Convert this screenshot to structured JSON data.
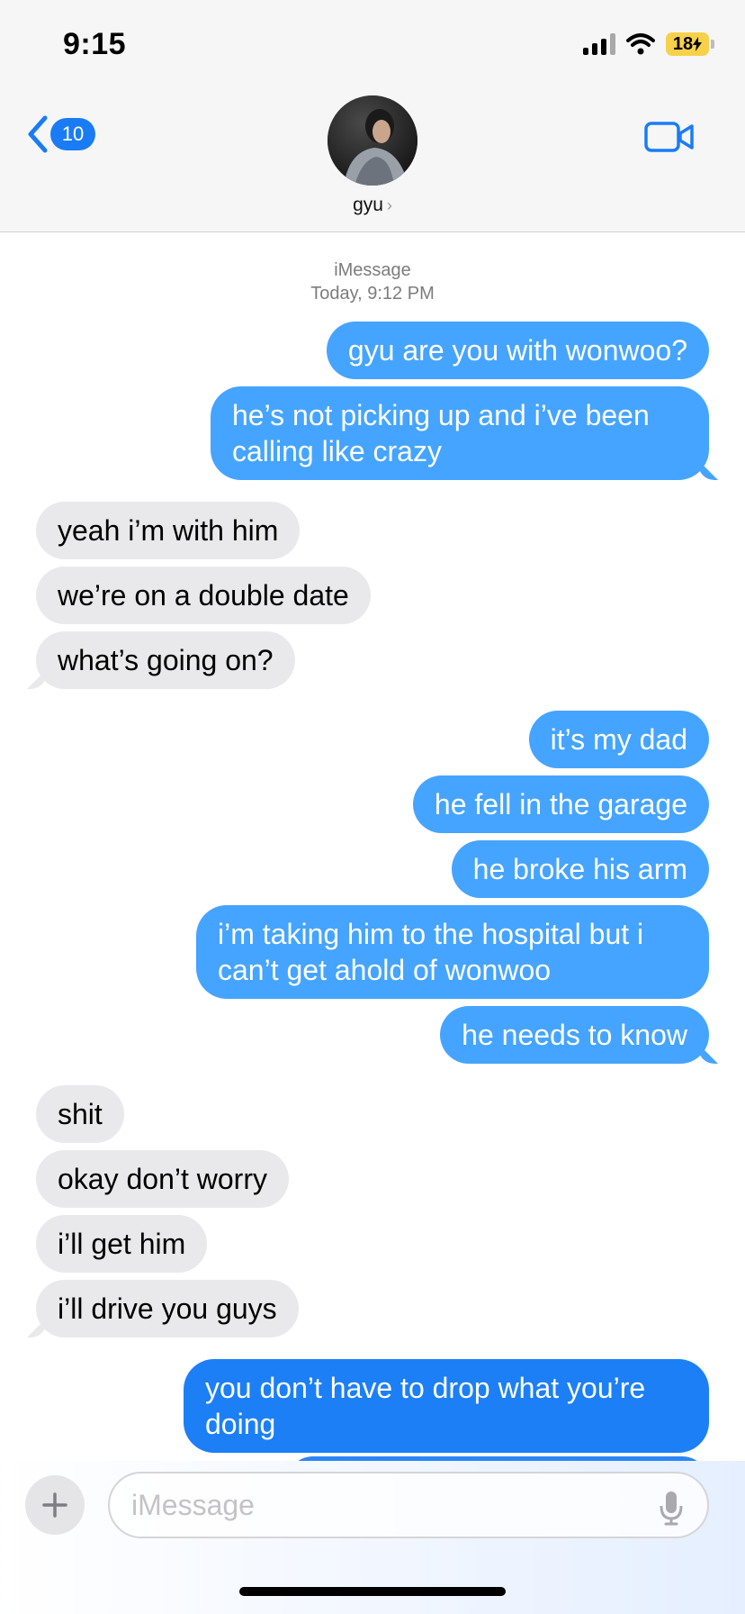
{
  "status_bar": {
    "time": "9:15",
    "battery": "18"
  },
  "header": {
    "back_count": "10",
    "contact_name": "gyu",
    "contact_chevron": "›",
    "icons": {
      "back": "chevron-left-icon",
      "video": "video-camera-icon",
      "avatar": "contact-avatar"
    },
    "colors": {
      "accent": "#1a7cf5"
    }
  },
  "transcript": {
    "service": "iMessage",
    "timestamp": "Today, 9:12 PM"
  },
  "messages": [
    {
      "sender": "me",
      "text": "gyu are you with wonwoo?"
    },
    {
      "sender": "me",
      "text": "he’s not picking up and i’ve been calling like crazy"
    },
    {
      "sender": "gyu",
      "text": "yeah i’m with him"
    },
    {
      "sender": "gyu",
      "text": "we’re on a double date"
    },
    {
      "sender": "gyu",
      "text": "what’s going on?"
    },
    {
      "sender": "me",
      "text": "it’s my dad"
    },
    {
      "sender": "me",
      "text": "he fell in the garage"
    },
    {
      "sender": "me",
      "text": "he broke his arm"
    },
    {
      "sender": "me",
      "text": "i’m taking him to the hospital but i can’t get ahold of wonwoo"
    },
    {
      "sender": "me",
      "text": "he needs to know"
    },
    {
      "sender": "gyu",
      "text": "shit"
    },
    {
      "sender": "gyu",
      "text": "okay don’t worry"
    },
    {
      "sender": "gyu",
      "text": "i’ll get him"
    },
    {
      "sender": "gyu",
      "text": "i’ll drive you guys"
    },
    {
      "sender": "me",
      "text": "you don’t have to drop what you’re doing"
    }
  ],
  "composer": {
    "placeholder": "iMessage",
    "plus_label": "+"
  },
  "colors": {
    "sent_bubble": "#45a4ff",
    "received_bubble": "#e9e9eb",
    "sent_text": "#ffffff"
  }
}
